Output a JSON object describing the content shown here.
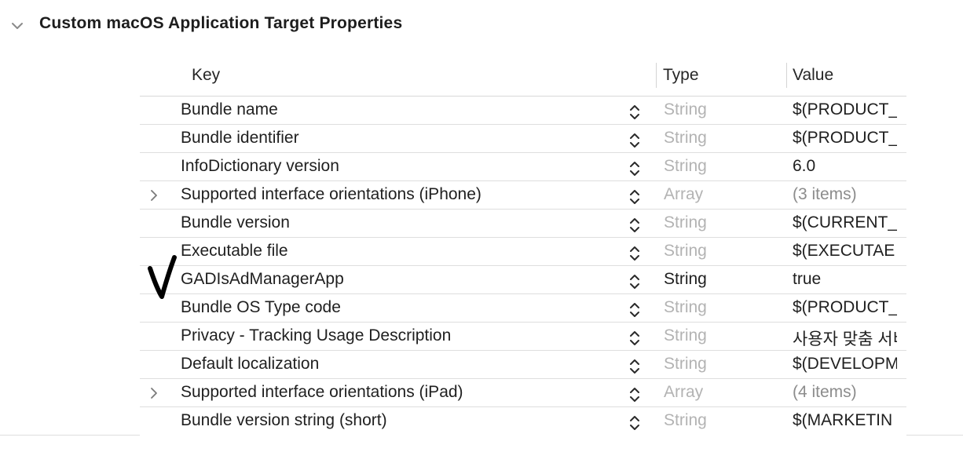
{
  "section": {
    "title": "Custom macOS Application Target Properties",
    "expanded": true
  },
  "table": {
    "columns": {
      "key": "Key",
      "type": "Type",
      "value": "Value"
    },
    "rows": [
      {
        "key": "Bundle name",
        "type": "String",
        "value": "$(PRODUCT_",
        "expandable": false,
        "type_active": false,
        "value_dim": false
      },
      {
        "key": "Bundle identifier",
        "type": "String",
        "value": "$(PRODUCT_",
        "expandable": false,
        "type_active": false,
        "value_dim": false
      },
      {
        "key": "InfoDictionary version",
        "type": "String",
        "value": "6.0",
        "expandable": false,
        "type_active": false,
        "value_dim": false
      },
      {
        "key": "Supported interface orientations (iPhone)",
        "type": "Array",
        "value": "(3 items)",
        "expandable": true,
        "type_active": false,
        "value_dim": true
      },
      {
        "key": "Bundle version",
        "type": "String",
        "value": "$(CURRENT_",
        "expandable": false,
        "type_active": false,
        "value_dim": false
      },
      {
        "key": "Executable file",
        "type": "String",
        "value": "$(EXECUTAE",
        "expandable": false,
        "type_active": false,
        "value_dim": false
      },
      {
        "key": "GADIsAdManagerApp",
        "type": "String",
        "value": "true",
        "expandable": false,
        "type_active": true,
        "value_dim": false
      },
      {
        "key": "Bundle OS Type code",
        "type": "String",
        "value": "$(PRODUCT_",
        "expandable": false,
        "type_active": false,
        "value_dim": false
      },
      {
        "key": "Privacy - Tracking Usage Description",
        "type": "String",
        "value": "사용자 맞춤 서비",
        "expandable": false,
        "type_active": false,
        "value_dim": false
      },
      {
        "key": "Default localization",
        "type": "String",
        "value": "$(DEVELOPM",
        "expandable": false,
        "type_active": false,
        "value_dim": false
      },
      {
        "key": "Supported interface orientations (iPad)",
        "type": "Array",
        "value": "(4 items)",
        "expandable": true,
        "type_active": false,
        "value_dim": true
      },
      {
        "key": "Bundle version string (short)",
        "type": "String",
        "value": "$(MARKETIN",
        "expandable": false,
        "type_active": false,
        "value_dim": false
      }
    ]
  },
  "icons": {
    "section_toggle": "chevron-down-icon",
    "row_expander": "chevron-right-icon",
    "row_stepper": "up-down-stepper-icon"
  },
  "colors": {
    "inactive_type": "#b3b3b3",
    "active_text": "#1f1f1f",
    "dim_value": "#8c8c8c",
    "annotation": "#000000"
  }
}
